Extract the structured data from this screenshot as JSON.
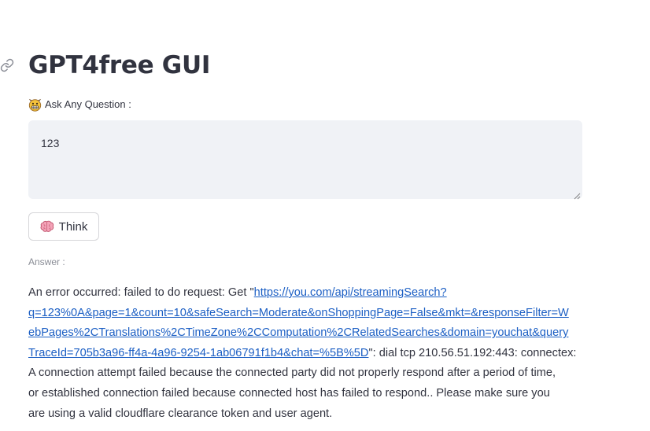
{
  "title": "GPT4free GUI",
  "icons": {
    "anchor": "link-icon",
    "question_emoji": "grimacing-face-icon",
    "think_emoji": "brain-icon"
  },
  "question": {
    "label": "Ask Any Question :",
    "value": "123"
  },
  "think_button": {
    "label": "Think"
  },
  "answer": {
    "label": "Answer :",
    "line1_prefix": "An error occurred: failed to do request: Get \"",
    "link_part1": "https://you.com/api/streamingSearch?",
    "link_part2": "q=123%0A&page=1&count=10&safeSearch=Moderate&onShoppingPage=False&mkt=&responseFilter=W",
    "link_part3": "ebPages%2CTranslations%2CTimeZone%2CComputation%2CRelatedSearches&domain=youchat&query",
    "link_part4": "TraceId=705b3a96-ff4a-4a96-9254-1ab06791f1b4&chat=%5B%5D",
    "line4_suffix": "\": dial tcp 210.56.51.192:443: connectex:",
    "line5": "A connection attempt failed because the connected party did not properly respond after a period of time,",
    "line6": "or established connection failed because connected host has failed to respond.. Please make sure you",
    "line7": "are using a valid cloudflare clearance token and user agent."
  },
  "colors": {
    "text": "#31333f",
    "input_bg": "#f0f2f6",
    "link": "#1c5fc4",
    "muted": "#8a8d96"
  }
}
